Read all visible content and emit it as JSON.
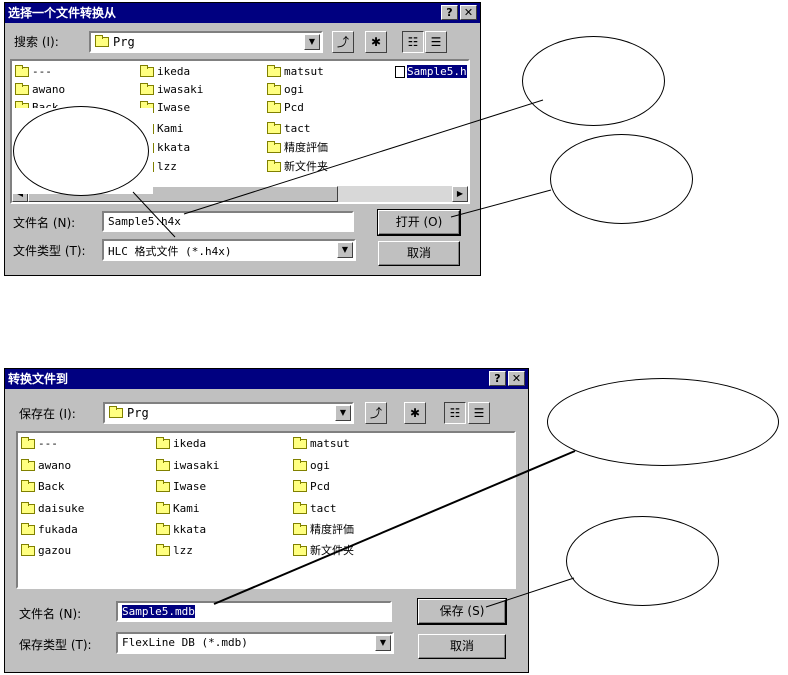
{
  "open_dialog": {
    "title": "选择一个文件转换从",
    "help_label": "?",
    "close_label": "✕",
    "lookin_label": "搜索 (I):",
    "lookin_value": "Prg",
    "up_icon": "up-folder-icon",
    "newfolder_icon": "new-folder-icon",
    "items": [
      {
        "name": "---",
        "type": "folder"
      },
      {
        "name": "awano",
        "type": "folder"
      },
      {
        "name": "Back",
        "type": "folder"
      },
      {
        "name": "ikeda",
        "type": "folder"
      },
      {
        "name": "iwasaki",
        "type": "folder"
      },
      {
        "name": "Iwase",
        "type": "folder"
      },
      {
        "name": "Kami",
        "type": "folder"
      },
      {
        "name": "kkata",
        "type": "folder"
      },
      {
        "name": "lzz",
        "type": "folder"
      },
      {
        "name": "matsut",
        "type": "folder"
      },
      {
        "name": "ogi",
        "type": "folder"
      },
      {
        "name": "Pcd",
        "type": "folder"
      },
      {
        "name": "tact",
        "type": "folder"
      },
      {
        "name": "精度評価",
        "type": "folder"
      },
      {
        "name": "新文件夹",
        "type": "folder"
      },
      {
        "name": "Sample5.h",
        "type": "file",
        "selected": true
      }
    ],
    "filename_label": "文件名 (N):",
    "filename_value": "Sample5.h4x",
    "filetype_label": "文件类型 (T):",
    "filetype_value": "HLC 格式文件 (*.h4x)",
    "open_button": "打开 (O)",
    "cancel_button": "取消"
  },
  "save_dialog": {
    "title": "转换文件到",
    "help_label": "?",
    "close_label": "✕",
    "savein_label": "保存在 (I):",
    "savein_value": "Prg",
    "items": [
      {
        "name": "---",
        "type": "folder"
      },
      {
        "name": "awano",
        "type": "folder"
      },
      {
        "name": "Back",
        "type": "folder"
      },
      {
        "name": "daisuke",
        "type": "folder"
      },
      {
        "name": "fukada",
        "type": "folder"
      },
      {
        "name": "gazou",
        "type": "folder"
      },
      {
        "name": "ikeda",
        "type": "folder"
      },
      {
        "name": "iwasaki",
        "type": "folder"
      },
      {
        "name": "Iwase",
        "type": "folder"
      },
      {
        "name": "Kami",
        "type": "folder"
      },
      {
        "name": "kkata",
        "type": "folder"
      },
      {
        "name": "lzz",
        "type": "folder"
      },
      {
        "name": "matsut",
        "type": "folder"
      },
      {
        "name": "ogi",
        "type": "folder"
      },
      {
        "name": "Pcd",
        "type": "folder"
      },
      {
        "name": "tact",
        "type": "folder"
      },
      {
        "name": "精度評価",
        "type": "folder"
      },
      {
        "name": "新文件夹",
        "type": "folder"
      }
    ],
    "filename_label": "文件名 (N):",
    "filename_value": "Sample5.mdb",
    "filetype_label": "保存类型 (T):",
    "filetype_value": "FlexLine DB (*.mdb)",
    "save_button": "保存 (S)",
    "cancel_button": "取消"
  },
  "colors": {
    "titlebar": "#000080",
    "dialog_face": "#c0c0c0",
    "selection": "#000080"
  }
}
